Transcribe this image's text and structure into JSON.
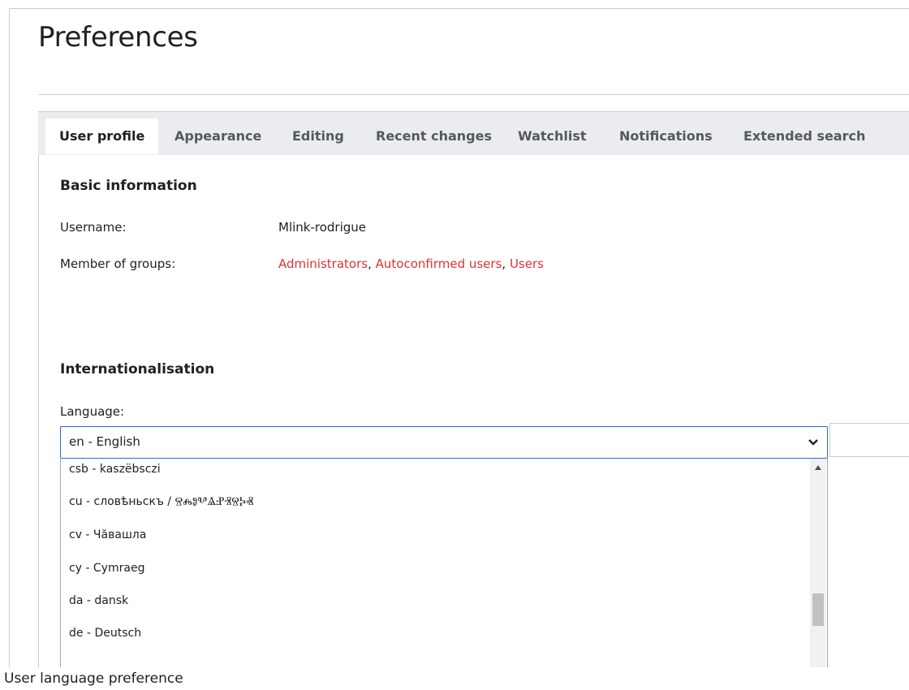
{
  "page": {
    "title": "Preferences"
  },
  "tabs": [
    {
      "label": "User profile",
      "selected": true
    },
    {
      "label": "Appearance",
      "selected": false
    },
    {
      "label": "Editing",
      "selected": false
    },
    {
      "label": "Recent changes",
      "selected": false
    },
    {
      "label": "Watchlist",
      "selected": false
    },
    {
      "label": "Notifications",
      "selected": false
    },
    {
      "label": "Extended search",
      "selected": false
    }
  ],
  "basic_info": {
    "heading": "Basic information",
    "username_label": "Username:",
    "username_value": "Mlink-rodrigue",
    "groups_label": "Member of groups:",
    "groups": [
      "Administrators",
      "Autoconfirmed users",
      "Users"
    ],
    "groups_separator": ", "
  },
  "i18n": {
    "heading": "Internationalisation",
    "language_label": "Language:",
    "language_selected": "en - English",
    "options": [
      "csb - kaszëbsczi",
      "cu - словѣньскъ / ⰔⰎⰑⰂⰡⰐⰠⰔⰍⰟ",
      "cv - Чӑвашла",
      "cy - Cymraeg",
      "da - dansk",
      "de - Deutsch"
    ]
  },
  "caption": "User language preference",
  "colors": {
    "link": "#dd3333",
    "accent": "#3366cc",
    "tab_bar": "#eaecf0"
  }
}
